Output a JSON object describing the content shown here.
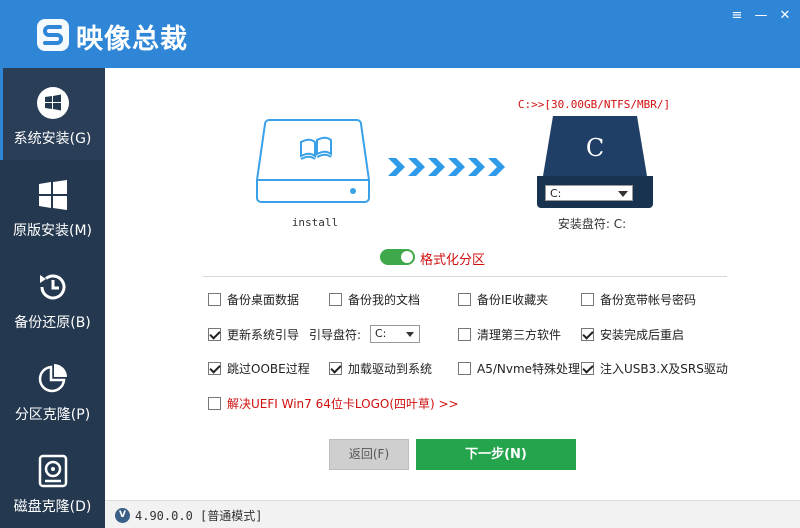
{
  "app": {
    "title": "映像总裁"
  },
  "window_buttons": {
    "menu": "≡",
    "minimize": "—",
    "close": "✕"
  },
  "sidebar": {
    "items": [
      {
        "label": "系统安装(G)",
        "icon": "windows-icon",
        "active": true
      },
      {
        "label": "原版安装(M)",
        "icon": "windows-grid-icon",
        "active": false
      },
      {
        "label": "备份还原(B)",
        "icon": "backup-clock-icon",
        "active": false
      },
      {
        "label": "分区克隆(P)",
        "icon": "pie-chart-icon",
        "active": false
      },
      {
        "label": "磁盘克隆(D)",
        "icon": "disk-clone-icon",
        "active": false
      }
    ]
  },
  "source": {
    "label": "install",
    "icon": "windows-disk-icon"
  },
  "target": {
    "path": "C:>>[30.00GB/NTFS/MBR/]",
    "drive_letter": "C",
    "selected_drive": "C:",
    "install_drive_label": "安装盘符: C:"
  },
  "format": {
    "label": "格式化分区",
    "enabled": true
  },
  "options": [
    {
      "label": "备份桌面数据",
      "checked": false
    },
    {
      "label": "备份我的文档",
      "checked": false
    },
    {
      "label": "备份IE收藏夹",
      "checked": false
    },
    {
      "label": "备份宽带帐号密码",
      "checked": false
    },
    {
      "label": "更新系统引导",
      "checked": true
    },
    {
      "label": "清理第三方软件",
      "checked": false
    },
    {
      "label": "安装完成后重启",
      "checked": true
    },
    {
      "label": "跳过OOBE过程",
      "checked": true
    },
    {
      "label": "加载驱动到系统",
      "checked": true
    },
    {
      "label": "A5/Nvme特殊处理",
      "checked": false
    },
    {
      "label": "注入USB3.X及SRS驱动",
      "checked": true
    },
    {
      "label": "解决UEFI Win7 64位卡LOGO(四叶草) >>",
      "checked": false
    }
  ],
  "guide": {
    "label": "引导盘符:",
    "value": "C:"
  },
  "buttons": {
    "back": "返回(F)",
    "next": "下一步(N)"
  },
  "status": {
    "version_icon": "V",
    "text": "4.90.0.0 [普通模式]"
  },
  "colors": {
    "title_bg": "#2f86d6",
    "sidebar_bg": "#24384f",
    "next_btn": "#24a44c",
    "warning_text": "#d01010"
  }
}
